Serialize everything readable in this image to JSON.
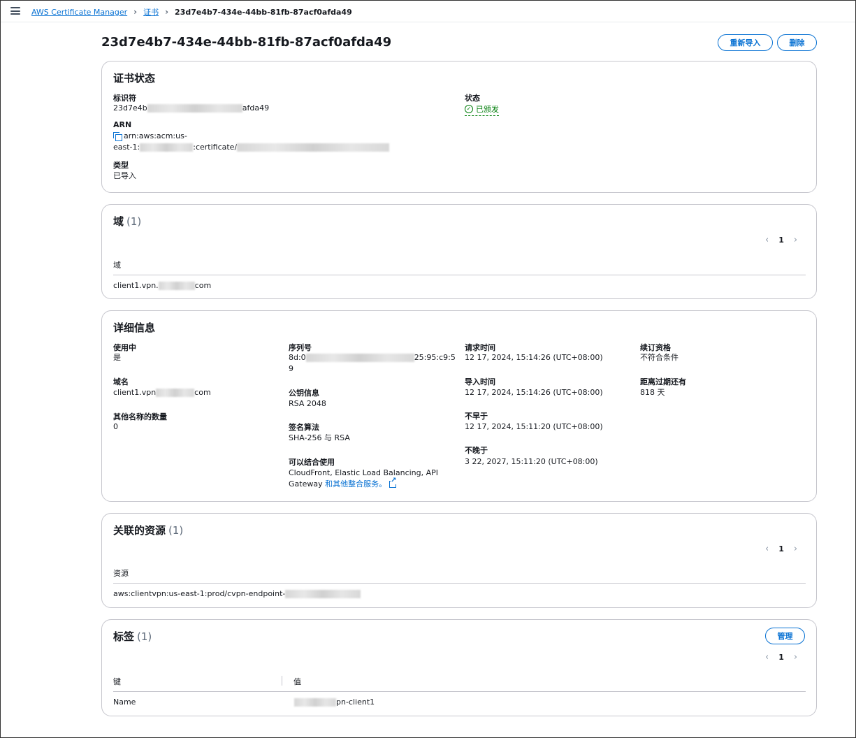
{
  "breadcrumb": {
    "items": [
      "AWS Certificate Manager",
      "证书"
    ],
    "current": "23d7e4b7-434e-44bb-81fb-87acf0afda49"
  },
  "header": {
    "title": "23d7e4b7-434e-44bb-81fb-87acf0afda49",
    "reimport_label": "重新导入",
    "delete_label": "删除"
  },
  "status_panel": {
    "title": "证书状态",
    "identifier_label": "标识符",
    "identifier_prefix": "23d7e4b",
    "identifier_suffix": "afda49",
    "status_label": "状态",
    "status_value": "已颁发",
    "arn_label": "ARN",
    "arn_line1": "arn:aws:acm:us-",
    "arn_line2_prefix": "east-1:",
    "arn_line2_mid": ":certificate/",
    "type_label": "类型",
    "type_value": "已导入"
  },
  "domains_panel": {
    "title": "域",
    "count": "(1)",
    "page": "1",
    "column": "域",
    "row_prefix": "client1.vpn.",
    "row_suffix": "com"
  },
  "details_panel": {
    "title": "详细信息",
    "in_use_label": "使用中",
    "in_use_value": "是",
    "domain_label": "域名",
    "domain_prefix": "client1.vpn",
    "domain_suffix": "com",
    "alt_names_label": "其他名称的数量",
    "alt_names_value": "0",
    "serial_label": "序列号",
    "serial_prefix": "8d:0",
    "serial_suffix": "25:95:c9:5",
    "serial_line2": "9",
    "pubkey_label": "公钥信息",
    "pubkey_value": "RSA 2048",
    "sig_label": "签名算法",
    "sig_value": "SHA-256 与 RSA",
    "usable_label": "可以结合使用",
    "usable_line1": "CloudFront, Elastic Load Balancing, API",
    "usable_line2": "Gateway",
    "usable_link": "和其他整合服务。",
    "requested_label": "请求时间",
    "requested_value": "12 17, 2024, 15:14:26 (UTC+08:00)",
    "imported_label": "导入时间",
    "imported_value": "12 17, 2024, 15:14:26 (UTC+08:00)",
    "not_before_label": "不早于",
    "not_before_value": "12 17, 2024, 15:11:20 (UTC+08:00)",
    "not_after_label": "不晚于",
    "not_after_value": "3 22, 2027, 15:11:20 (UTC+08:00)",
    "renewal_label": "续订资格",
    "renewal_value": "不符合条件",
    "expiry_label": "距离过期还有",
    "expiry_value": "818 天"
  },
  "resources_panel": {
    "title": "关联的资源",
    "count": "(1)",
    "page": "1",
    "column": "资源",
    "row_prefix": "aws:clientvpn:us-east-1:prod/cvpn-endpoint-"
  },
  "tags_panel": {
    "title": "标签",
    "count": "(1)",
    "manage_label": "管理",
    "page": "1",
    "key_column": "键",
    "value_column": "值",
    "row_key": "Name",
    "row_value_suffix": "pn-client1"
  },
  "icons": {
    "menu": "hamburger-menu-icon",
    "breadcrumb_separator": "chevron-right-icon",
    "status": "check-circle-icon",
    "copy": "copy-icon",
    "external": "external-link-icon",
    "pager_prev": "chevron-left-icon",
    "pager_next": "chevron-right-icon"
  },
  "colors": {
    "link": "#0972d3",
    "success": "#037f0c",
    "border": "#c6c6cd"
  }
}
